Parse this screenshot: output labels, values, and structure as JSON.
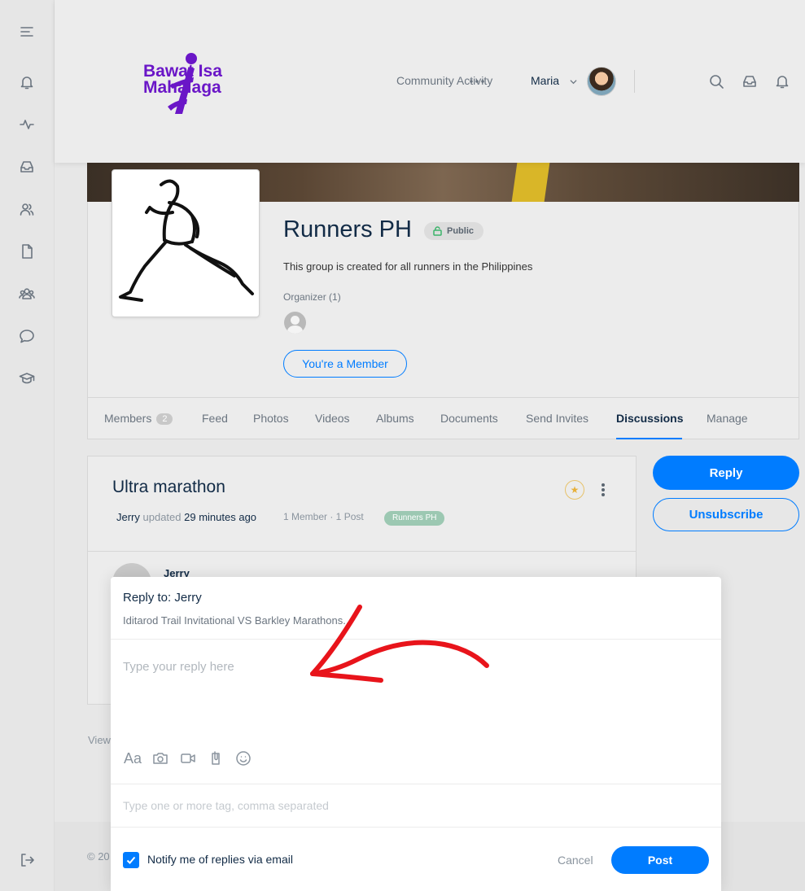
{
  "brand": {
    "logo_line1": "Bawat Isa",
    "logo_line2": "Mahalaga",
    "accent": "#6a16c7"
  },
  "header": {
    "nav_community": "Community Activity",
    "user_name": "Maria"
  },
  "rail": {
    "icons": [
      "menu-icon",
      "bell-icon",
      "activity-icon",
      "inbox-icon",
      "users-icon",
      "document-icon",
      "groups-icon",
      "chat-icon",
      "courses-icon",
      "logout-icon"
    ]
  },
  "group": {
    "title": "Runners PH",
    "privacy_badge": "Public",
    "description": "This group is created for all runners in the Philippines",
    "organizer_label": "Organizer (1)",
    "member_button": "You're a Member"
  },
  "tabs": [
    {
      "label": "Members",
      "count": "2"
    },
    {
      "label": "Feed"
    },
    {
      "label": "Photos"
    },
    {
      "label": "Videos"
    },
    {
      "label": "Albums"
    },
    {
      "label": "Documents"
    },
    {
      "label": "Send Invites"
    },
    {
      "label": "Discussions",
      "active": true
    },
    {
      "label": "Manage"
    }
  ],
  "discussion": {
    "title": "Ultra marathon",
    "author": "Jerry",
    "updated_label": "updated",
    "time_ago": "29 minutes ago",
    "stats": "1 Member · 1 Post",
    "forum_tag": "Runners PH",
    "reply_author": "Jerry"
  },
  "actions": {
    "reply": "Reply",
    "unsubscribe": "Unsubscribe"
  },
  "page_bits": {
    "view_text": "View",
    "footer_text": "© 20"
  },
  "reply_modal": {
    "title": "Reply to: Jerry",
    "excerpt": "Iditarod Trail Invitational VS Barkley Marathons...",
    "reply_placeholder": "Type your reply here",
    "format_label": "Aa",
    "tags_placeholder": "Type one or more tag, comma separated",
    "notify_label": "Notify me of replies via email",
    "notify_checked": true,
    "cancel": "Cancel",
    "post": "Post"
  },
  "colors": {
    "primary": "#007cff",
    "annotation_arrow": "#e8141b"
  }
}
